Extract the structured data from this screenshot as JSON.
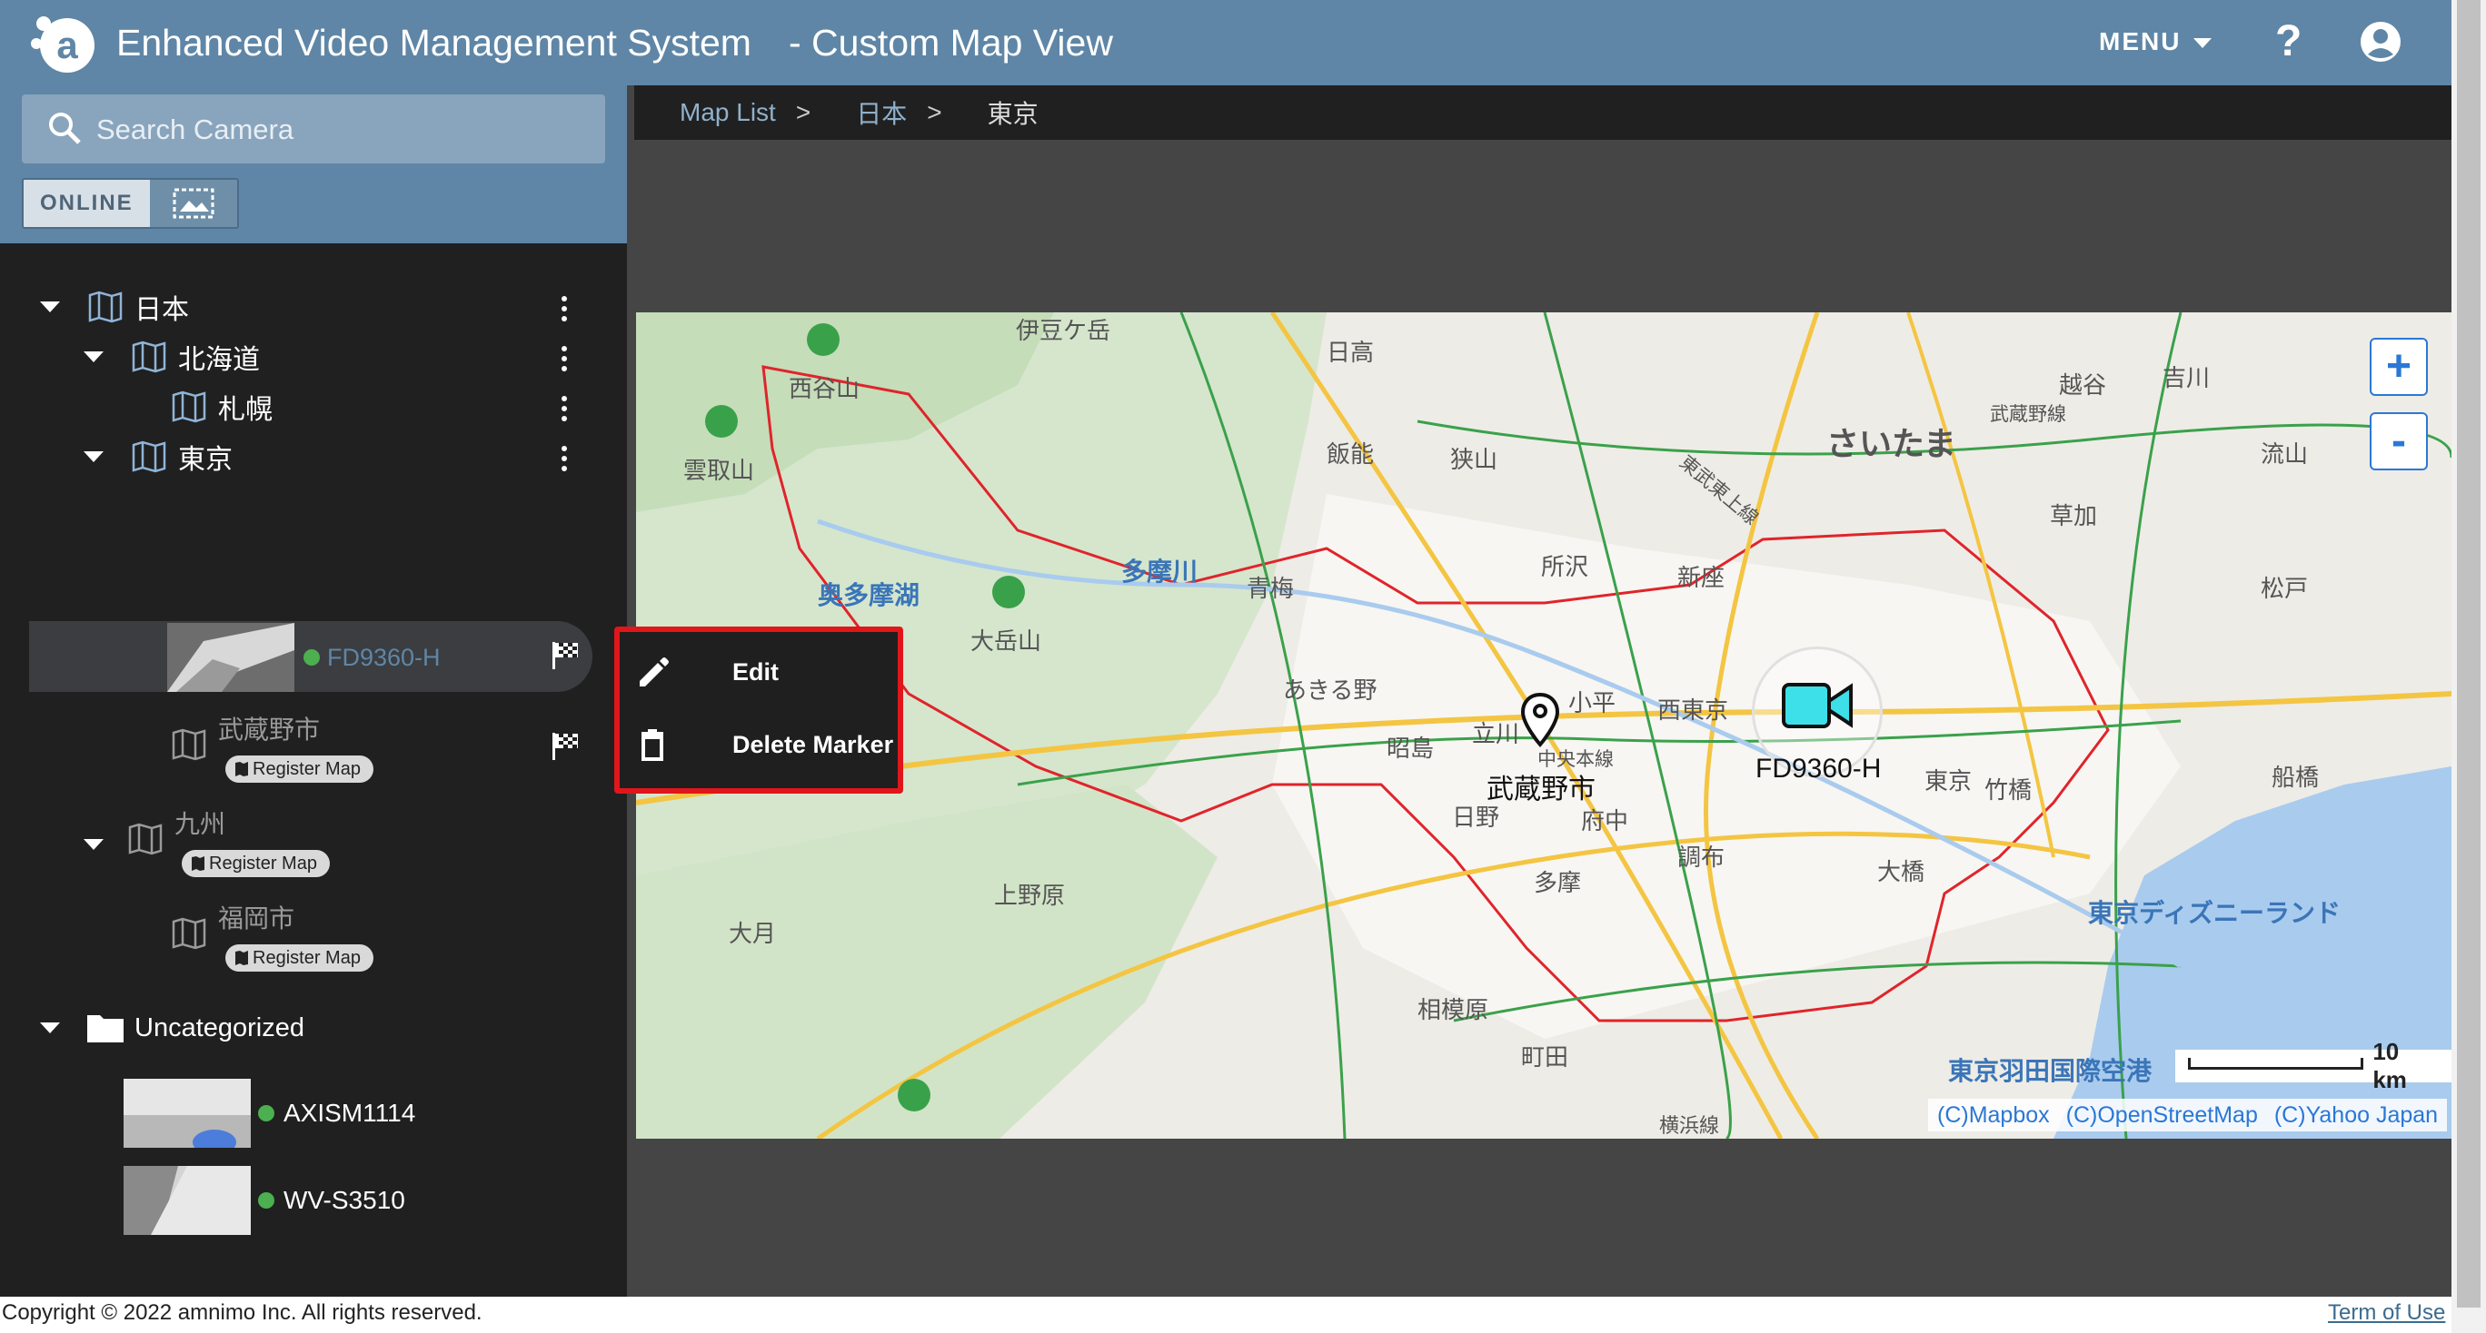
{
  "header": {
    "title": "Enhanced Video Management System　- Custom Map View",
    "menu_label": "MENU",
    "help_label": "?"
  },
  "search": {
    "placeholder": "Search Camera",
    "value": ""
  },
  "filter": {
    "online_label": "ONLINE"
  },
  "breadcrumb": {
    "items": [
      "Map List",
      "日本",
      "東京"
    ],
    "separator": ">"
  },
  "tree": {
    "root": "日本",
    "hokkaido": "北海道",
    "sapporo": "札幌",
    "tokyo": "東京",
    "selected_camera": "FD9360-H",
    "musashino": "武蔵野市",
    "kyushu": "九州",
    "fukuoka": "福岡市",
    "register_label": "Register Map",
    "uncategorized": "Uncategorized",
    "cameras": [
      "AXISM1114",
      "WV-S3510"
    ]
  },
  "context_menu": {
    "edit": "Edit",
    "delete": "Delete Marker"
  },
  "map": {
    "marker_place": "武蔵野市",
    "marker_camera": "FD9360-H",
    "labels": [
      "伊豆ケ岳",
      "日高",
      "西谷山",
      "雲取山",
      "飯能",
      "狭山",
      "所沢",
      "さいたま",
      "越谷",
      "吉川",
      "草加",
      "流山",
      "松戸",
      "奥多摩湖",
      "大岳山",
      "多摩川",
      "青梅",
      "あきる野",
      "昭島",
      "立川",
      "小平",
      "西東京",
      "新座",
      "中央本線",
      "日野",
      "府中",
      "調布",
      "多摩",
      "東京",
      "竹橋",
      "大橋",
      "船橋",
      "東京ディズニーランド",
      "上野原",
      "大月",
      "相模原",
      "町田",
      "横浜線",
      "東京羽田国際空港",
      "武蔵野線",
      "東武東上線"
    ],
    "scale_label": "10 km",
    "attribution": [
      "(C)Mapbox",
      "(C)OpenStreetMap",
      "(C)Yahoo Japan"
    ],
    "zoom_in": "+",
    "zoom_out": "-"
  },
  "footer": {
    "copyright": "Copyright © 2022 amnimo Inc. All rights reserved.",
    "terms": "Term of Use"
  },
  "colors": {
    "header": "#5f86a6",
    "sidebar": "#202020",
    "accent": "#2a78d6",
    "highlight_border": "#e0161b",
    "status_online": "#4caf50",
    "camera_marker": "#3de0e8"
  }
}
